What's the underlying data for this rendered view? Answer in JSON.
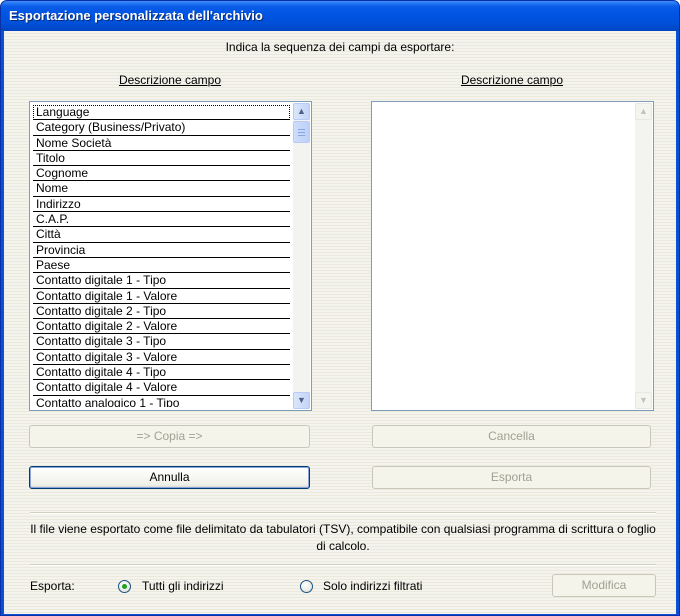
{
  "window": {
    "title": "Esportazione personalizzata dell'archivio"
  },
  "instruction": "Indica la sequenza dei campi da esportare:",
  "left_column_header": "Descrizione campo",
  "right_column_header": "Descrizione campo",
  "available_fields": [
    "Language",
    "Category (Business/Privato)",
    "Nome Società",
    "Titolo",
    "Cognome",
    "Nome",
    "Indirizzo",
    "C.A.P.",
    "Città",
    "Provincia",
    "Paese",
    "Contatto digitale 1 - Tipo",
    "Contatto digitale 1 - Valore",
    "Contatto digitale 2 - Tipo",
    "Contatto digitale 2 - Valore",
    "Contatto digitale 3 - Tipo",
    "Contatto digitale 3 - Valore",
    "Contatto digitale 4 - Tipo",
    "Contatto digitale 4 - Valore",
    "Contatto analogico 1 - Tipo"
  ],
  "selected_fields": [],
  "buttons": {
    "copy": "=> Copia =>",
    "delete": "Cancella",
    "cancel": "Annulla",
    "export": "Esporta",
    "modify": "Modifica"
  },
  "info_text": "Il file viene esportato come file delimitato da tabulatori (TSV), compatibile con qualsiasi programma di scrittura o foglio di calcolo.",
  "export_label": "Esporta:",
  "radio": {
    "all": "Tutti gli indirizzi",
    "filtered": "Solo indirizzi filtrati",
    "selected": "all"
  },
  "icons": {
    "scroll_up": "arrow-up-icon",
    "scroll_down": "arrow-down-icon"
  },
  "colors": {
    "titlebar": "#0054e3",
    "dialog_background": "#f1efe2",
    "radio_dot": "#21a121"
  }
}
